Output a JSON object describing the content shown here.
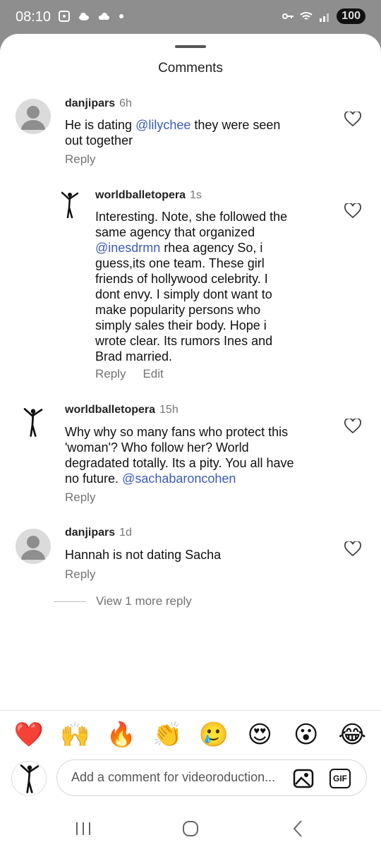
{
  "status": {
    "time": "08:10",
    "battery": "100"
  },
  "sheet": {
    "title": "Comments"
  },
  "comments": [
    {
      "user": "danjipars",
      "time": "6h",
      "text_lines": [
        "He is dating ",
        "@lilychee",
        " they were seen",
        "out together"
      ],
      "reply": "Reply"
    },
    {
      "user": "worldballetopera",
      "time": "1s",
      "text_lines": [
        "Interesting. Note, she followed the",
        "same agency that organized",
        "@inesdrmn",
        " rhea agency So, i",
        "guess,its one team. These girl",
        "friends of hollywood celebrity. I",
        "dont envy. I simply dont want to",
        "make popularity persons who",
        "simply sales their body. Hope i",
        "wrote clear. Its rumors Ines and",
        "Brad married."
      ],
      "reply": "Reply",
      "edit": "Edit"
    },
    {
      "user": "worldballetopera",
      "time": "15h",
      "text_lines": [
        "Why why so many fans who protect this",
        "'woman'? Who follow her? World",
        "degradated totally. Its a pity. You all have",
        "no future. ",
        "@sachabaroncohen"
      ],
      "reply": "Reply"
    },
    {
      "user": "danjipars",
      "time": "1d",
      "text_lines": [
        "Hannah is not dating Sacha"
      ],
      "reply": "Reply"
    }
  ],
  "view_more": "View 1 more reply",
  "emojis": [
    "❤️",
    "🙌",
    "🔥",
    "👏",
    "🥲",
    "😍",
    "😮",
    "😂"
  ],
  "composer": {
    "placeholder": "Add a comment for videoroduction...",
    "gif": "GIF"
  },
  "icons": {
    "heart": "heart-outline-icon",
    "image": "image-icon",
    "gif": "gif-icon"
  }
}
